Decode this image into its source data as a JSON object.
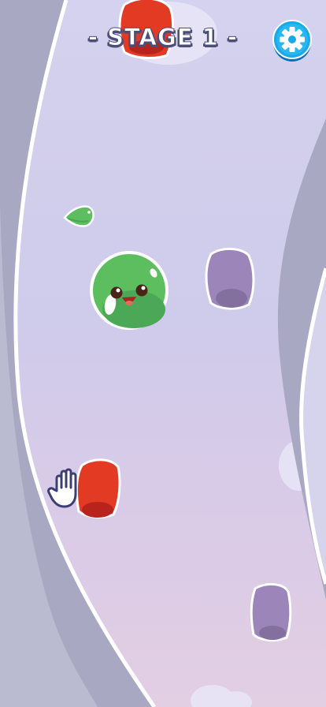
{
  "hud": {
    "stage_label": "- STAGE 1 -"
  },
  "icons": {
    "settings": "gear-icon",
    "hint": "hand-pointer-icon"
  },
  "colors": {
    "background_top": "#d4d2ee",
    "background_bottom": "#e2cfe3",
    "track_wall": "#a9a8c2",
    "track_outline": "#ffffff",
    "slime_green": "#5cbe5f",
    "block_red": "#e23a23",
    "block_purple": "#9c86b9",
    "settings_button": "#19a9e8"
  }
}
